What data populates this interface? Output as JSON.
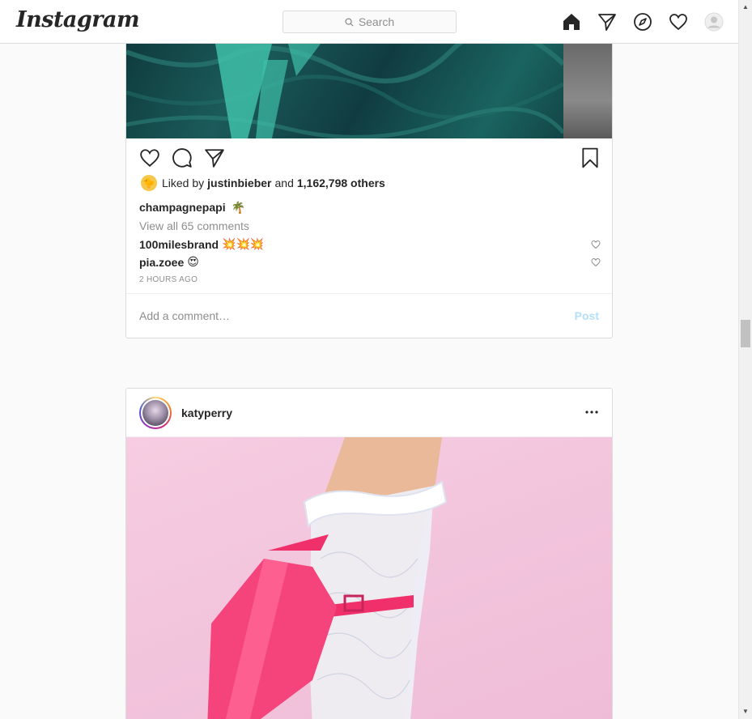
{
  "nav": {
    "logo": "Instagram",
    "search_placeholder": "Search"
  },
  "post1": {
    "liked_prefix": "Liked by",
    "liked_user": "justinbieber",
    "liked_and": "and",
    "liked_others": "1,162,798 others",
    "caption_user": "champagnepapi",
    "caption_emoji": "🌴",
    "view_comments": "View all 65 comments",
    "comments": [
      {
        "user": "100milesbrand",
        "text": "💥💥💥"
      },
      {
        "user": "pia.zoee",
        "text": "😍"
      }
    ],
    "timestamp": "2 HOURS AGO",
    "comment_placeholder": "Add a comment…",
    "post_label": "Post",
    "image_colors": {
      "primary": "#0f3b3d",
      "accent": "#1a6460"
    }
  },
  "post2": {
    "username": "katyperry",
    "image_background": "#f2c4dc"
  },
  "colors": {
    "border": "#dbdbdb",
    "muted": "#8e8e8e",
    "post_button_disabled": "#b2dffc"
  }
}
